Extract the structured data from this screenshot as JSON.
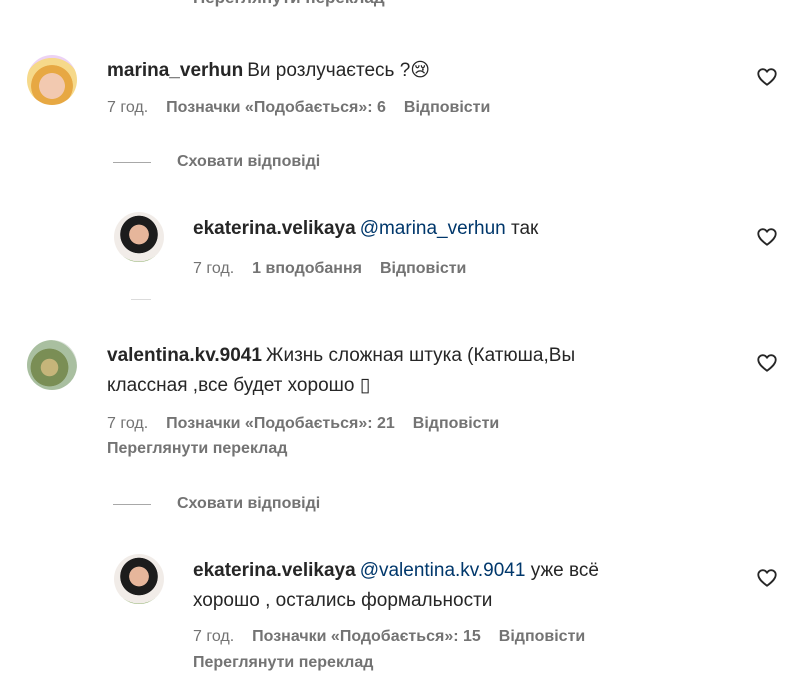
{
  "top_cut": {
    "translate_label": "Переглянути переклад"
  },
  "comments": [
    {
      "username": "marina_verhun",
      "text": "Ви розлучаєтесь ?😢",
      "time": "7 год.",
      "likes": "Позначки «Подобається»: 6",
      "reply": "Відповісти",
      "hide_replies": "Сховати відповіді",
      "replies": [
        {
          "username": "ekaterina.velikaya",
          "mention": "@marina_verhun",
          "text": " так",
          "time": "7 год.",
          "likes": "1 вподобання",
          "reply": "Відповісти"
        }
      ]
    },
    {
      "username": "valentina.kv.9041",
      "text_line1": "Жизнь сложная штука (Катюша,Вы",
      "text_line2": "классная ,все будет хорошо ",
      "missing_glyph": "▯",
      "time": "7 год.",
      "likes": "Позначки «Подобається»: 21",
      "reply": "Відповісти",
      "translate": "Переглянути переклад",
      "hide_replies": "Сховати відповіді",
      "replies": [
        {
          "username": "ekaterina.velikaya",
          "mention": "@valentina.kv.9041",
          "text_line1": " уже всё",
          "text_line2": "хорошо , остались формальности",
          "time": "7 год.",
          "likes": "Позначки «Подобається»: 15",
          "reply": "Відповісти",
          "translate": "Переглянути переклад"
        }
      ]
    }
  ],
  "icons": {
    "like": "heart-outline-icon"
  },
  "colors": {
    "text": "#262626",
    "secondary": "#737373",
    "mention": "#00376b"
  }
}
